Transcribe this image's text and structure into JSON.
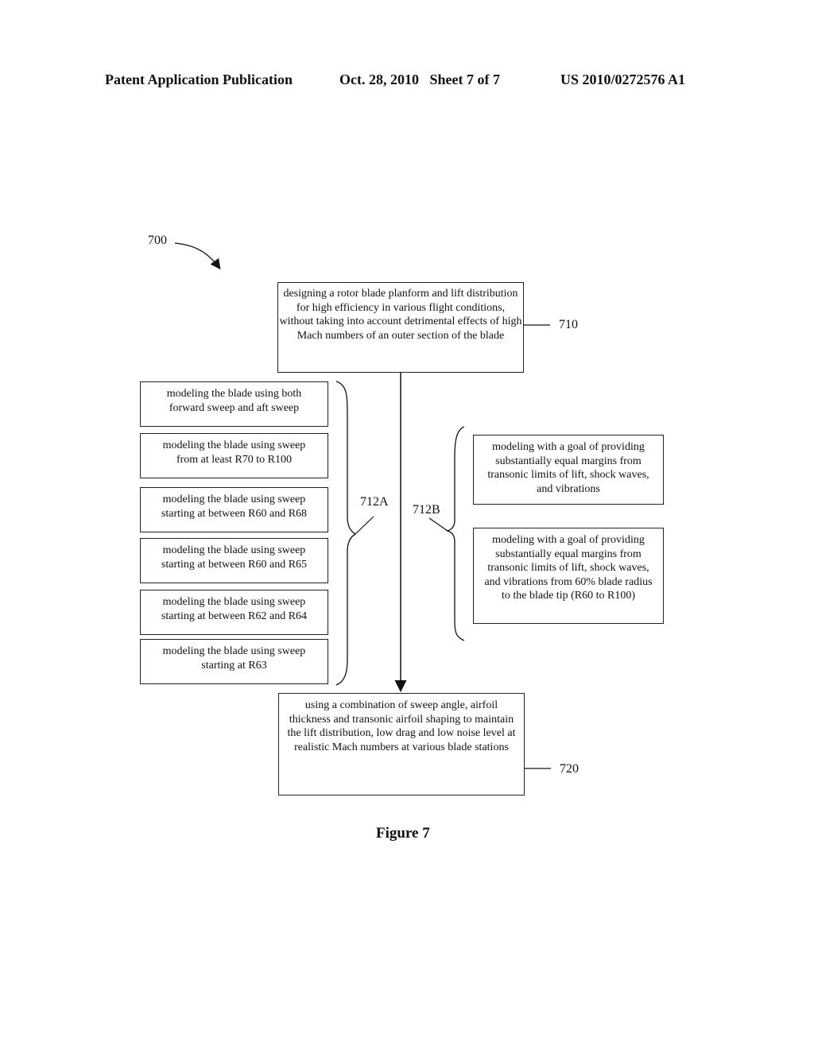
{
  "header": {
    "publication": "Patent Application Publication",
    "date_sheet": "Oct. 28, 2010   Sheet 7 of 7",
    "patent_number": "US 2010/0272576 A1"
  },
  "diagram": {
    "figure_ref": "700",
    "step_710": {
      "ref": "710",
      "text": "designing a rotor blade planform and lift distribution for high efficiency in various flight conditions, without taking into account detrimental effects of high Mach numbers of an outer section of the blade"
    },
    "group_712A": {
      "ref": "712A",
      "items": [
        "modeling the blade using both forward sweep and aft sweep",
        "modeling the blade using sweep from at least R70 to R100",
        "modeling the blade using sweep starting at between R60 and R68",
        "modeling the blade using sweep starting at between R60 and R65",
        "modeling the blade using sweep starting at between R62 and R64",
        "modeling the blade using sweep starting at R63"
      ]
    },
    "group_712B": {
      "ref": "712B",
      "items": [
        "modeling with a goal of providing substantially equal margins from transonic limits of lift, shock waves, and vibrations",
        "modeling with a goal of providing substantially equal margins from transonic limits of lift, shock waves, and vibrations from 60% blade radius to the blade tip (R60 to R100)"
      ]
    },
    "step_720": {
      "ref": "720",
      "text": "using a combination of sweep angle, airfoil thickness and transonic airfoil shaping to maintain the lift distribution, low drag and low noise level at realistic Mach numbers at various blade stations"
    },
    "caption": "Figure 7"
  }
}
